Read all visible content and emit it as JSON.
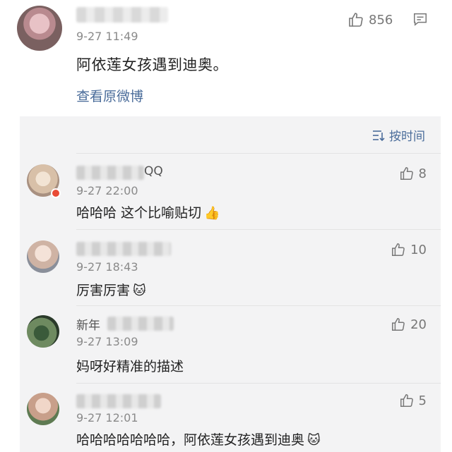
{
  "main": {
    "time": "9-27 11:49",
    "text": "阿依莲女孩遇到迪奥。",
    "view_original": "查看原微博",
    "likes": "856"
  },
  "replies_header": {
    "sort_label": "按时间"
  },
  "replies": [
    {
      "name_suffix": "QQ",
      "time": "9-27 22:00",
      "text": "哈哈哈 这个比喻贴切",
      "emoji": "👍",
      "likes": "8"
    },
    {
      "name_suffix": "",
      "time": "9-27 18:43",
      "text": "厉害厉害",
      "emoji": "🐱",
      "likes": "10"
    },
    {
      "name_prefix": "新年",
      "time": "9-27 13:09",
      "text": "妈呀好精准的描述",
      "emoji": "",
      "likes": "20"
    },
    {
      "name_suffix": "",
      "time": "9-27 12:01",
      "text": "哈哈哈哈哈哈哈，阿依莲女孩遇到迪奥",
      "emoji": "🐱",
      "likes": "5"
    }
  ]
}
